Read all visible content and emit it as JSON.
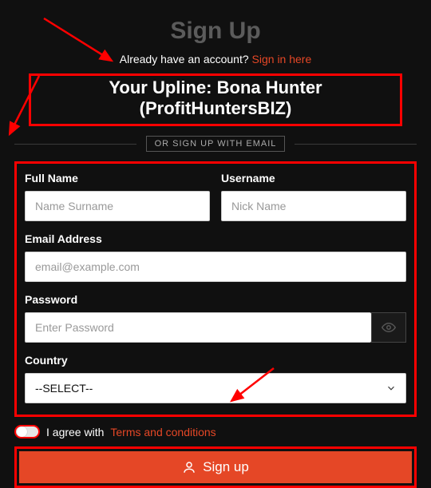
{
  "title": "Sign Up",
  "subtitle": {
    "text": "Already have an account? ",
    "link": "Sign in here"
  },
  "upline": "Your Upline: Bona Hunter (ProfitHuntersBIZ)",
  "divider": "OR SIGN UP WITH EMAIL",
  "fields": {
    "fullname": {
      "label": "Full Name",
      "placeholder": "Name Surname"
    },
    "username": {
      "label": "Username",
      "placeholder": "Nick Name"
    },
    "email": {
      "label": "Email Address",
      "placeholder": "email@example.com"
    },
    "password": {
      "label": "Password",
      "placeholder": "Enter Password"
    },
    "country": {
      "label": "Country",
      "selected": "--SELECT--"
    }
  },
  "agree": {
    "text": "I agree with ",
    "link": "Terms and conditions"
  },
  "button": "Sign up"
}
